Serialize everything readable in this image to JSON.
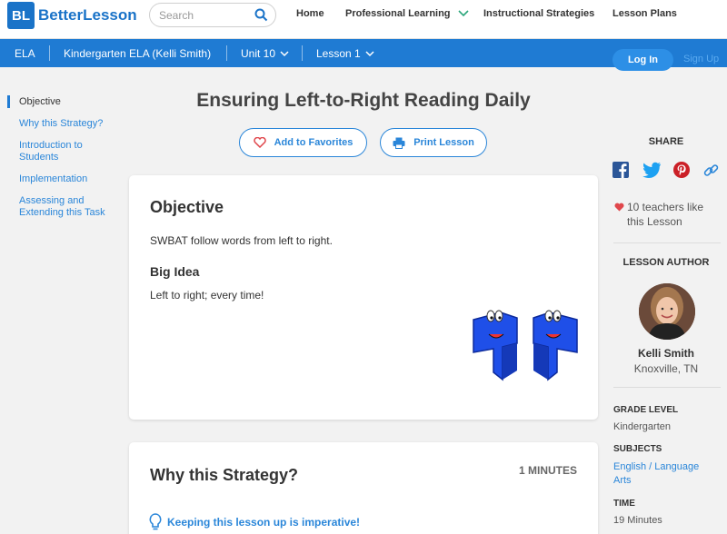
{
  "brand": {
    "badge": "BL",
    "name": "BetterLesson"
  },
  "search": {
    "placeholder": "Search"
  },
  "topnav": {
    "home": "Home",
    "professional_learning": "Professional Learning",
    "instructional_strategies": "Instructional Strategies",
    "lesson_plans": "Lesson Plans"
  },
  "crumbs": {
    "subject": "ELA",
    "course": "Kindergarten ELA (Kelli Smith)",
    "unit": "Unit 10",
    "lesson": "Lesson 1"
  },
  "auth": {
    "login": "Log In",
    "signup": "Sign Up"
  },
  "sidenav": {
    "items": [
      {
        "label": "Objective"
      },
      {
        "label": "Why this Strategy?"
      },
      {
        "label": "Introduction to Students"
      },
      {
        "label": "Implementation"
      },
      {
        "label": "Assessing and Extending this Task"
      }
    ]
  },
  "lesson": {
    "title": "Ensuring Left-to-Right Reading Daily",
    "add_favorites": "Add to Favorites",
    "print": "Print Lesson"
  },
  "objective_card": {
    "heading": "Objective",
    "objective_text": "SWBAT follow words from left to right.",
    "big_idea_heading": "Big Idea",
    "big_idea_text": "Left to right; every time!"
  },
  "strategy_card": {
    "heading": "Why this Strategy?",
    "minutes": "1 MINUTES",
    "tip": "Keeping this lesson up is imperative!"
  },
  "sidebar": {
    "share_label": "SHARE",
    "likes": "10 teachers like this Lesson",
    "author_label": "LESSON AUTHOR",
    "author_name": "Kelli Smith",
    "author_location": "Knoxville, TN",
    "grade_label": "GRADE LEVEL",
    "grade_value": "Kindergarten",
    "subjects_label": "SUBJECTS",
    "subjects_value": "English / Language Arts",
    "time_label": "TIME",
    "time_value": "19 Minutes"
  },
  "colors": {
    "brand_blue": "#1f7bd3",
    "link_blue": "#2a86d9",
    "heart_red": "#e0474c"
  }
}
